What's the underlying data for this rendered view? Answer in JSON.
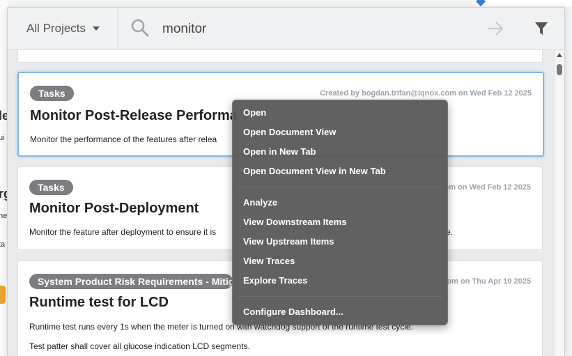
{
  "search": {
    "project_label": "All Projects",
    "query": "monitor"
  },
  "results": [
    {
      "category": "Tasks",
      "meta": "Created by bogdan.trifan@iqnox.com on Wed Feb 12 2025",
      "title": "Monitor Post-Release Performa",
      "description": "Monitor the performance of the features after relea"
    },
    {
      "category": "Tasks",
      "meta": "om on Wed Feb 12 2025",
      "title": "Monitor Post-Deployment",
      "description": "Monitor the feature after deployment to ensure it is",
      "description_tail": "e."
    },
    {
      "category": "System Product Risk Requirements - Mitig",
      "meta": "com on Thu Apr 10 2025",
      "title": "Runtime test for LCD",
      "description": "Runtime test runs every 1s when the meter is turned on with watchdog support of the runtime test cycle.",
      "description2": "Test patter shall cover all glucose indication LCD segments."
    }
  ],
  "context_menu": {
    "group1": [
      "Open",
      "Open Document View",
      "Open in New Tab",
      "Open Document View in New Tab"
    ],
    "group2": [
      "Analyze",
      "View Downstream Items",
      "View Upstream Items",
      "View Traces",
      "Explore Traces"
    ],
    "group3": [
      "Configure Dashboard..."
    ]
  },
  "background_fragments": [
    "le",
    "ui",
    "rg",
    "ne",
    "ta"
  ],
  "colors": {
    "accent": "#7fb6e6",
    "chip": "#7b7d80",
    "menu_bg": "#585858"
  }
}
